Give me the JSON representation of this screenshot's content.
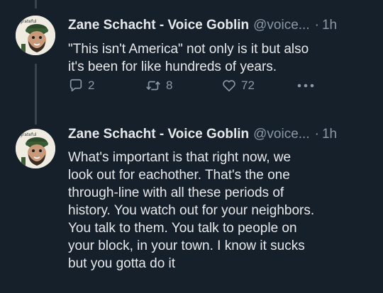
{
  "tweets": [
    {
      "display_name": "Zane Schacht - Voice Goblin",
      "handle": "@voice...",
      "separator": "·",
      "time": "1h",
      "text": "\"This isn't America\" not only is it but also\nit's been for like hundreds of years.",
      "replies": "2",
      "retweets": "8",
      "likes": "72",
      "avatar_text": "grateful"
    },
    {
      "display_name": "Zane Schacht - Voice Goblin",
      "handle": "@voice...",
      "separator": "·",
      "time": "1h",
      "text": "What's important is that right now, we\nlook out for eachother. That's the one\nthrough-line with all these periods of\nhistory. You watch out for your neighbors.\nYou talk to them. You talk to people on\nyour block, in your town. I know it sucks\nbut you gotta do it",
      "avatar_text": "grateful"
    }
  ],
  "colors": {
    "background": "#15202b",
    "text": "#e7e9ea",
    "secondary": "#8b98a5",
    "thread_line": "#38444d"
  }
}
